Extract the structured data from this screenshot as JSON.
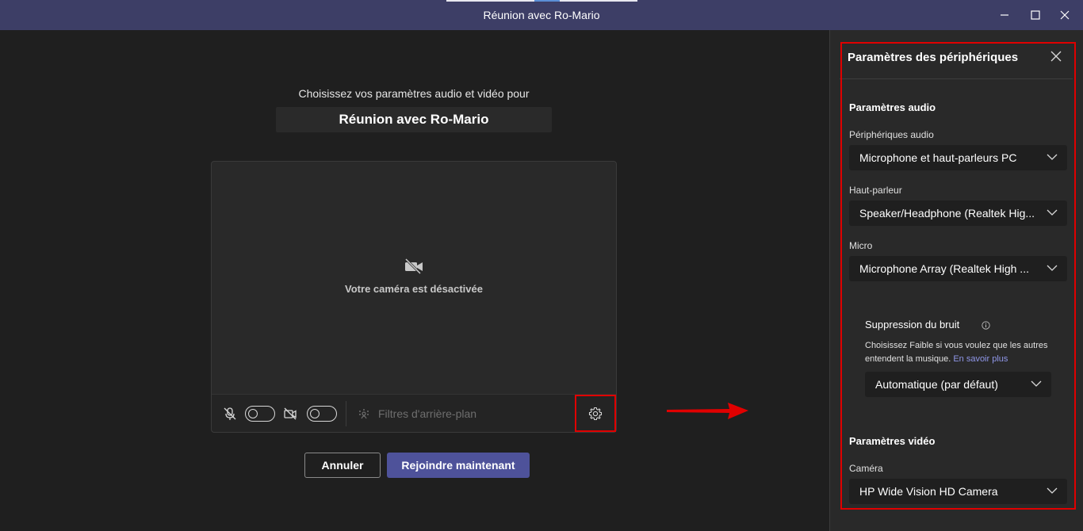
{
  "window": {
    "title": "Réunion avec Ro-Mario"
  },
  "main": {
    "prompt": "Choisissez vos paramètres audio et vidéo pour",
    "meeting_name": "Réunion avec Ro-Mario",
    "camera_off_message": "Votre caméra est désactivée",
    "background_filters_label": "Filtres d'arrière-plan",
    "mic_enabled": false,
    "camera_enabled": false,
    "cancel_label": "Annuler",
    "join_label": "Rejoindre maintenant"
  },
  "panel": {
    "title": "Paramètres des périphériques",
    "audio_section": "Paramètres audio",
    "audio_devices_label": "Périphériques audio",
    "audio_devices_value": "Microphone et haut-parleurs PC",
    "speaker_label": "Haut-parleur",
    "speaker_value": "Speaker/Headphone (Realtek Hig...",
    "mic_label": "Micro",
    "mic_value": "Microphone Array (Realtek High ...",
    "noise_title": "Suppression du bruit",
    "noise_desc": "Choisissez Faible si vous voulez que les autres entendent la musique.",
    "noise_link": "En savoir plus",
    "noise_value": "Automatique (par défaut)",
    "video_section": "Paramètres vidéo",
    "camera_label": "Caméra",
    "camera_value": "HP Wide Vision HD Camera"
  },
  "colors": {
    "titlebar": "#3d3e66",
    "accent": "#4e529a",
    "highlight": "#e00000",
    "link": "#8f96e8"
  }
}
